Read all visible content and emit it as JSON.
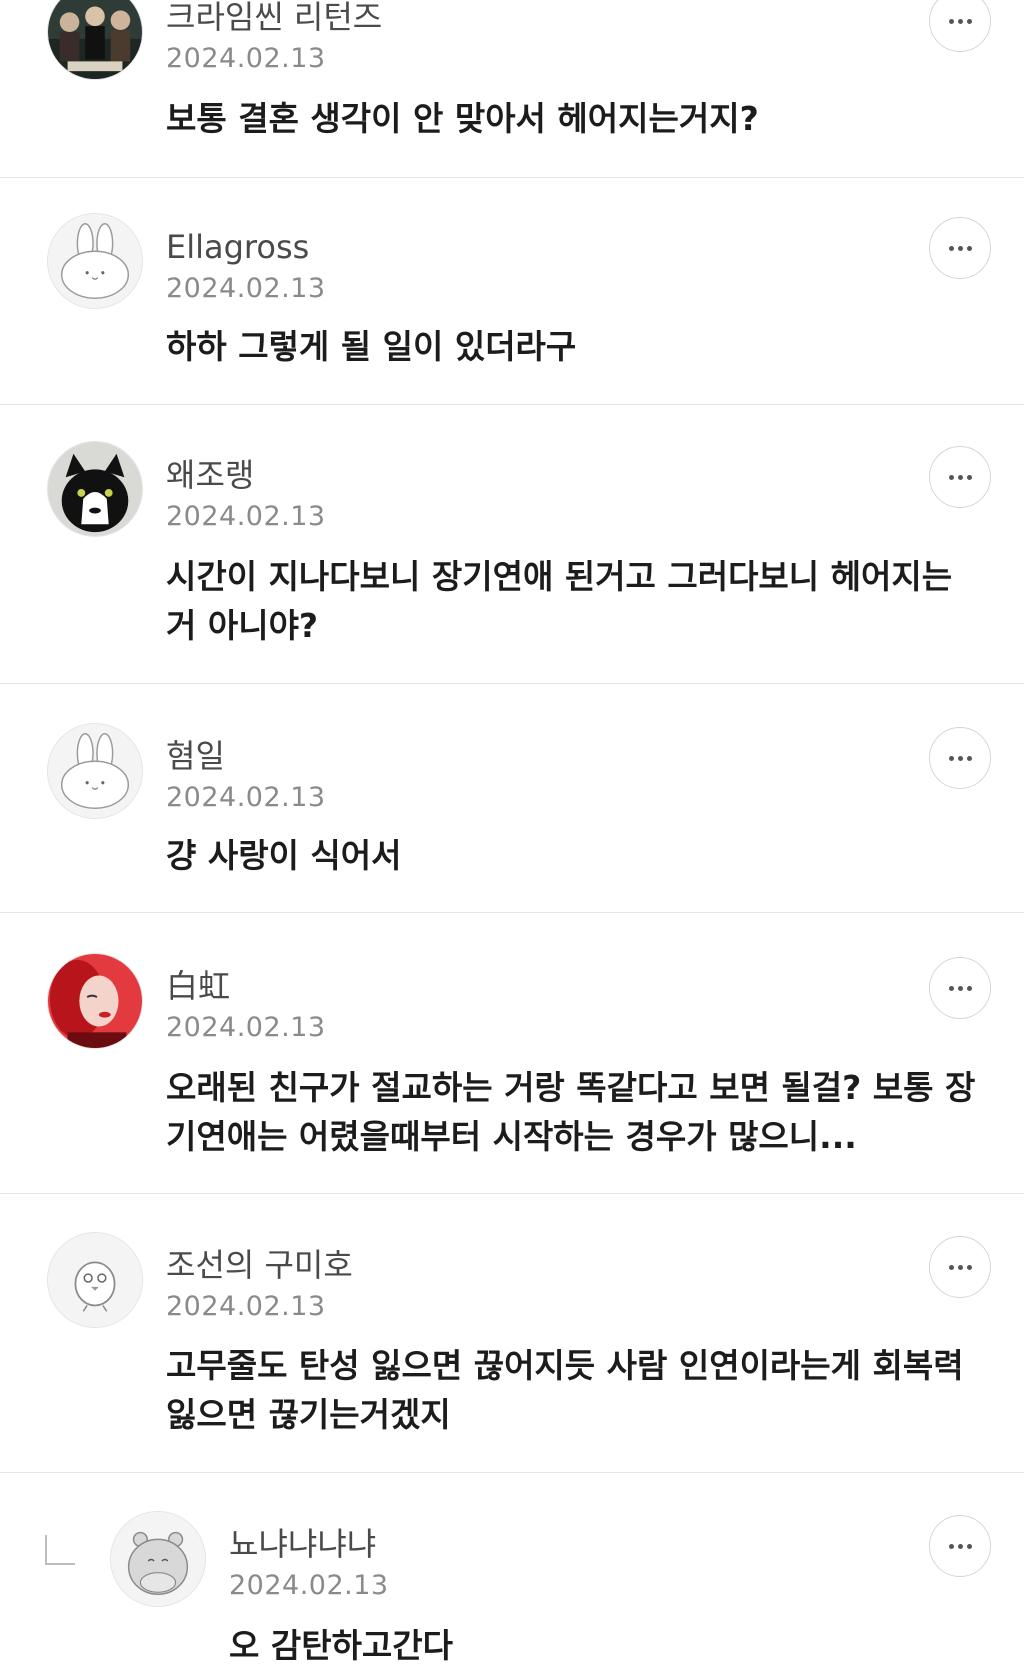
{
  "comments": [
    {
      "name": "크라임씬 리턴즈",
      "date": "2024.02.13",
      "text": "보통 결혼 생각이 안 맞아서 헤어지는거지?",
      "avatar": "crimescene-poster-avatar"
    },
    {
      "name": "Ellagross",
      "date": "2024.02.13",
      "text": "하하 그렇게 될 일이 있더라구",
      "avatar": "rabbit-avatar"
    },
    {
      "name": "왜조랭",
      "date": "2024.02.13",
      "text": "시간이 지나다보니 장기연애 된거고 그러다보니 헤어지는 거 아니야?",
      "avatar": "cat-photo-avatar"
    },
    {
      "name": "혐일",
      "date": "2024.02.13",
      "text": "걍 사랑이 식어서",
      "avatar": "rabbit-avatar"
    },
    {
      "name": "白虹",
      "date": "2024.02.13",
      "text": "오래된 친구가 절교하는 거랑 똑같다고 보면 될걸? 보통 장기연애는 어렸을때부터 시작하는 경우가 많으니...",
      "avatar": "red-hair-photo-avatar"
    },
    {
      "name": "조선의 구미호",
      "date": "2024.02.13",
      "text": "고무줄도 탄성 잃으면 끊어지듯 사람 인연이라는게 회복력 잃으면 끊기는거겠지",
      "avatar": "chick-avatar"
    },
    {
      "name": "뇨냐냐냐냐",
      "date": "2024.02.13",
      "text": "오 감탄하고간다",
      "avatar": "hippo-avatar",
      "reply": true
    }
  ],
  "colors": {
    "divider": "#e6e6e6",
    "name": "#4a4a4a",
    "date": "#8a8a8a",
    "text": "#1c1c1c"
  }
}
